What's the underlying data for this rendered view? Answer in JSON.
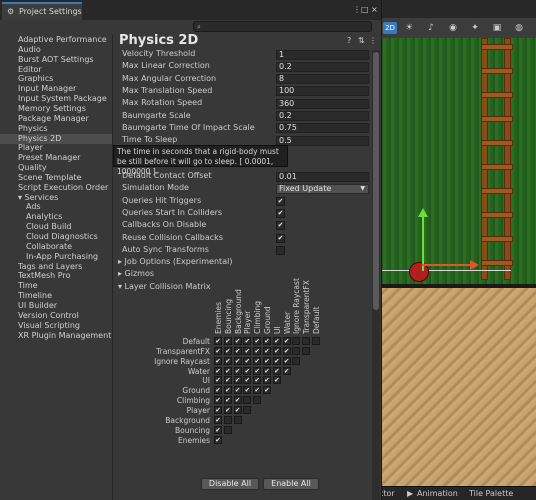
{
  "window": {
    "tab_title": "Project Settings",
    "tab_icon": "gear-icon",
    "menu_icon": "kebab-menu-icon",
    "maximize_icon": "maximize-icon",
    "close_icon": "close-icon",
    "search_placeholder": ""
  },
  "sidebar": {
    "items": [
      {
        "label": "Adaptive Performance",
        "indent": 0
      },
      {
        "label": "Audio",
        "indent": 0
      },
      {
        "label": "Burst AOT Settings",
        "indent": 0
      },
      {
        "label": "Editor",
        "indent": 0
      },
      {
        "label": "Graphics",
        "indent": 0
      },
      {
        "label": "Input Manager",
        "indent": 0
      },
      {
        "label": "Input System Package",
        "indent": 0
      },
      {
        "label": "Memory Settings",
        "indent": 0
      },
      {
        "label": "Package Manager",
        "indent": 0
      },
      {
        "label": "Physics",
        "indent": 0
      },
      {
        "label": "Physics 2D",
        "indent": 0,
        "selected": true
      },
      {
        "label": "Player",
        "indent": 0
      },
      {
        "label": "Preset Manager",
        "indent": 0
      },
      {
        "label": "Quality",
        "indent": 0
      },
      {
        "label": "Scene Template",
        "indent": 0
      },
      {
        "label": "Script Execution Order",
        "indent": 0
      },
      {
        "label": "▾ Services",
        "indent": 0
      },
      {
        "label": "Ads",
        "indent": 1
      },
      {
        "label": "Analytics",
        "indent": 1
      },
      {
        "label": "Cloud Build",
        "indent": 1
      },
      {
        "label": "Cloud Diagnostics",
        "indent": 1
      },
      {
        "label": "Collaborate",
        "indent": 1
      },
      {
        "label": "In-App Purchasing",
        "indent": 1
      },
      {
        "label": "Tags and Layers",
        "indent": 0
      },
      {
        "label": "TextMesh Pro",
        "indent": 0
      },
      {
        "label": "Time",
        "indent": 0
      },
      {
        "label": "Timeline",
        "indent": 0
      },
      {
        "label": "UI Builder",
        "indent": 0
      },
      {
        "label": "Version Control",
        "indent": 0
      },
      {
        "label": "Visual Scripting",
        "indent": 0
      },
      {
        "label": "XR Plugin Management",
        "indent": 0
      }
    ]
  },
  "panel": {
    "title": "Physics 2D",
    "help_icon": "help-icon",
    "preset_icon": "preset-icon",
    "menu_icon": "kebab-menu-icon",
    "fields": [
      {
        "label": "Velocity Threshold",
        "value": "1"
      },
      {
        "label": "Max Linear Correction",
        "value": "0.2"
      },
      {
        "label": "Max Angular Correction",
        "value": "8"
      },
      {
        "label": "Max Translation Speed",
        "value": "100"
      },
      {
        "label": "Max Rotation Speed",
        "value": "360"
      },
      {
        "label": "Baumgarte Scale",
        "value": "0.2"
      },
      {
        "label": "Baumgarte Time Of Impact Scale",
        "value": "0.75"
      },
      {
        "label": "Time To Sleep",
        "value": "0.5"
      }
    ],
    "contact_offset": {
      "label": "Default Contact Offset",
      "value": "0.01"
    },
    "simulation_mode": {
      "label": "Simulation Mode",
      "value": "Fixed Update"
    },
    "toggles": [
      {
        "label": "Queries Hit Triggers",
        "checked": true
      },
      {
        "label": "Queries Start In Colliders",
        "checked": true
      },
      {
        "label": "Callbacks On Disable",
        "checked": true
      },
      {
        "label": "Reuse Collision Callbacks",
        "checked": true
      },
      {
        "label": "Auto Sync Transforms",
        "checked": false
      }
    ],
    "foldouts": [
      {
        "label": "▸ Job Options (Experimental)"
      },
      {
        "label": "▸ Gizmos"
      },
      {
        "label": "▾ Layer Collision Matrix"
      }
    ],
    "tooltip": "The time in seconds that a rigid-body must be still before it will go to sleep. [ 0.0001, 1000000  ]."
  },
  "matrix": {
    "layers": [
      "Default",
      "TransparentFX",
      "Ignore Raycast",
      "Water",
      "UI",
      "Ground",
      "Climbing",
      "Player",
      "Background",
      "Bouncing",
      "Enemies"
    ],
    "checked": [
      [
        1,
        1,
        1,
        1,
        1,
        1,
        1,
        1,
        0,
        0,
        0
      ],
      [
        1,
        1,
        1,
        1,
        1,
        1,
        1,
        1,
        0,
        0
      ],
      [
        1,
        1,
        1,
        1,
        1,
        1,
        1,
        1,
        0
      ],
      [
        1,
        1,
        1,
        1,
        1,
        1,
        1,
        1
      ],
      [
        1,
        1,
        1,
        1,
        1,
        1,
        1
      ],
      [
        1,
        1,
        1,
        1,
        1,
        1
      ],
      [
        1,
        1,
        1,
        0,
        0
      ],
      [
        1,
        1,
        1,
        0
      ],
      [
        1,
        0,
        0
      ],
      [
        1,
        0
      ],
      [
        1
      ]
    ],
    "disable_all_label": "Disable All",
    "enable_all_label": "Enable All"
  },
  "scene": {
    "mode_2d_label": "2D",
    "toolbar_icons": [
      "lighting-icon",
      "audio-icon",
      "visibility-icon",
      "effects-icon",
      "camera-icon",
      "gizmos-icon"
    ],
    "bottom_tabs": [
      "ctor",
      "Animation",
      "Tile Palette"
    ]
  }
}
